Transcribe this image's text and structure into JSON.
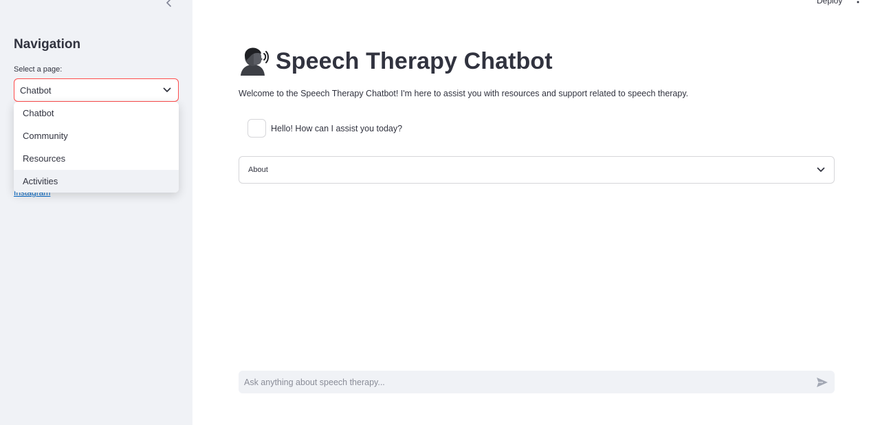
{
  "sidebar": {
    "title": "Navigation",
    "select_label": "Select a page:",
    "selected_page": "Chatbot",
    "options": [
      "Chatbot",
      "Community",
      "Resources",
      "Activities"
    ],
    "partially_hidden_link": "Instagram"
  },
  "toolbar": {
    "deploy_label": "Deploy",
    "menu_icon": "vertical-dots-icon"
  },
  "main": {
    "title_emoji": "speaking-head-emoji",
    "title": "Speech Therapy Chatbot",
    "welcome_text": "Welcome to the Speech Therapy Chatbot! I'm here to assist you with resources and support related to speech therapy.",
    "assistant_message": "Hello! How can I assist you today?",
    "expander_label": "About",
    "chat_placeholder": "Ask anything about speech therapy..."
  },
  "colors": {
    "sidebar_bg": "#f0f2f6",
    "text": "#31333f",
    "focus_border": "#ff4b4b",
    "link": "#0068c9",
    "muted": "#808495"
  }
}
